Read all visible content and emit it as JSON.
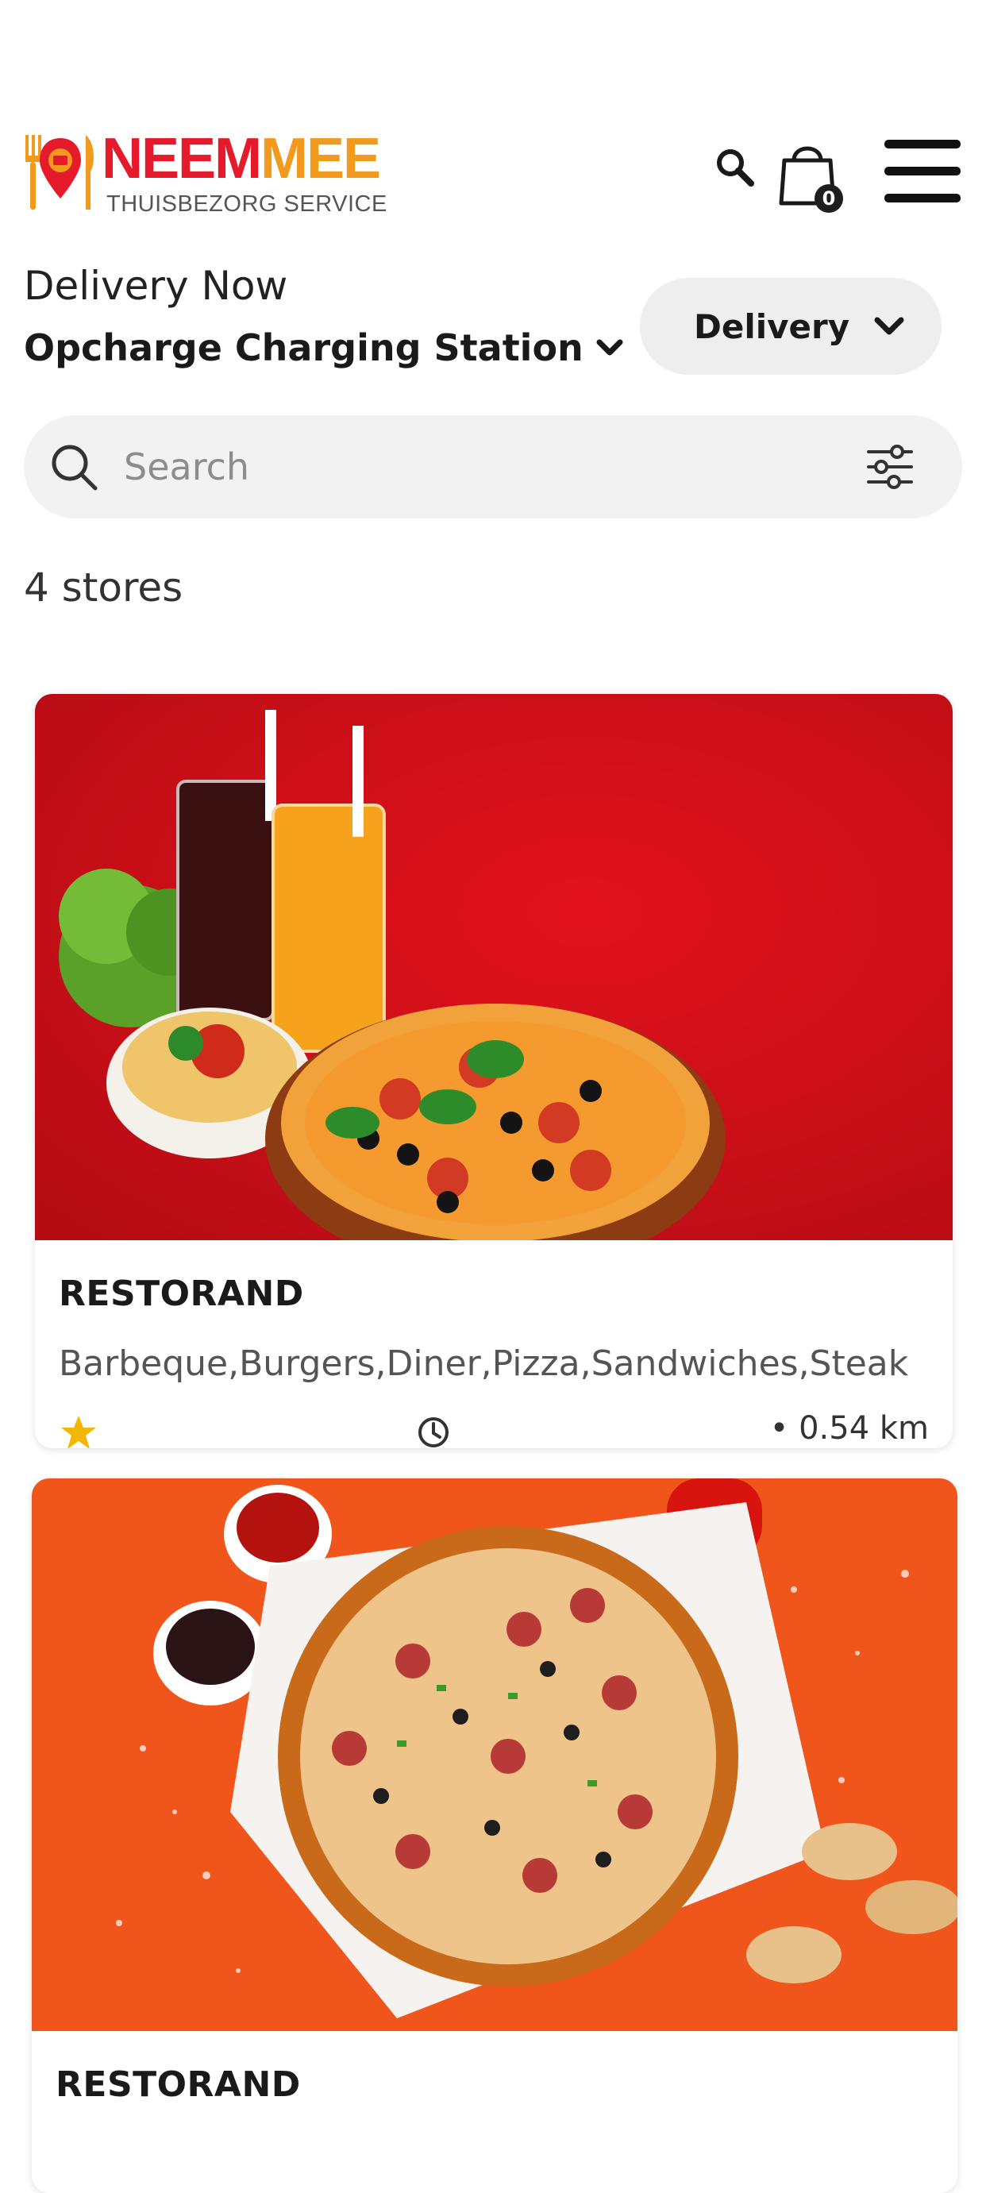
{
  "header": {
    "brand_part1": "NEEM",
    "brand_part2": "MEE",
    "tagline": "THUISBEZORG SERVICE",
    "cart_count": "0",
    "icons": [
      "search-icon",
      "cart-bag-icon",
      "hamburger-menu-icon"
    ]
  },
  "delivery": {
    "heading": "Delivery Now",
    "location": "Opcharge Charging Station",
    "mode_label": "Delivery"
  },
  "search": {
    "placeholder": "Search"
  },
  "stores": {
    "count_label": "4 stores",
    "items": [
      {
        "name": "RESTORAND",
        "cuisines": "Barbeque,Burgers,Diner,Pizza,Sandwiches,Steak",
        "distance": "• 0.54 km"
      },
      {
        "name": "RESTORAND"
      }
    ]
  },
  "colors": {
    "brand_red": "#e51a2a",
    "brand_orange": "#f29a1d",
    "card1_bg": "#d4101a",
    "card2_bg": "#f0561c"
  }
}
